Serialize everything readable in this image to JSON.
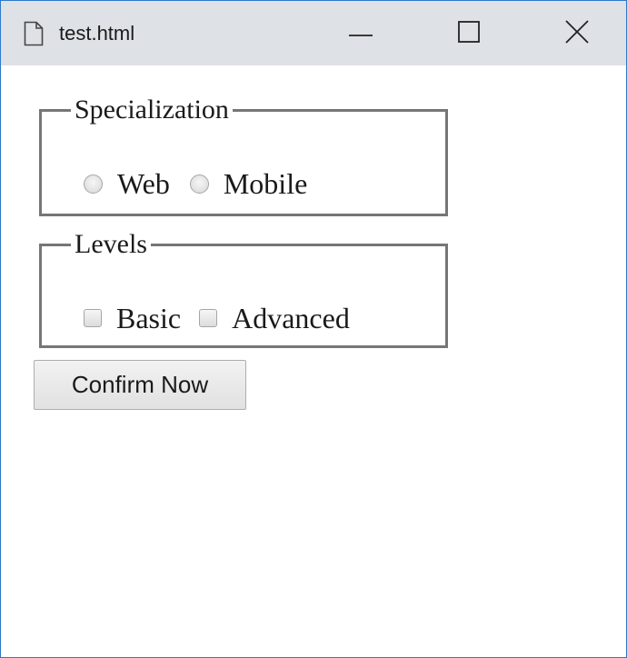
{
  "window": {
    "title": "test.html",
    "accent_color": "#2b79c9",
    "titlebar_color": "#dee1e6"
  },
  "icons": {
    "document": "document-icon",
    "minimize": "minimize-icon",
    "maximize": "maximize-icon",
    "close": "close-icon"
  },
  "specialization": {
    "legend": "Specialization",
    "options": [
      {
        "label": "Web",
        "checked": false
      },
      {
        "label": "Mobile",
        "checked": false
      }
    ]
  },
  "levels": {
    "legend": "Levels",
    "options": [
      {
        "label": "Basic",
        "checked": false
      },
      {
        "label": "Advanced",
        "checked": false
      }
    ]
  },
  "actions": {
    "confirm_label": "Confirm Now"
  }
}
